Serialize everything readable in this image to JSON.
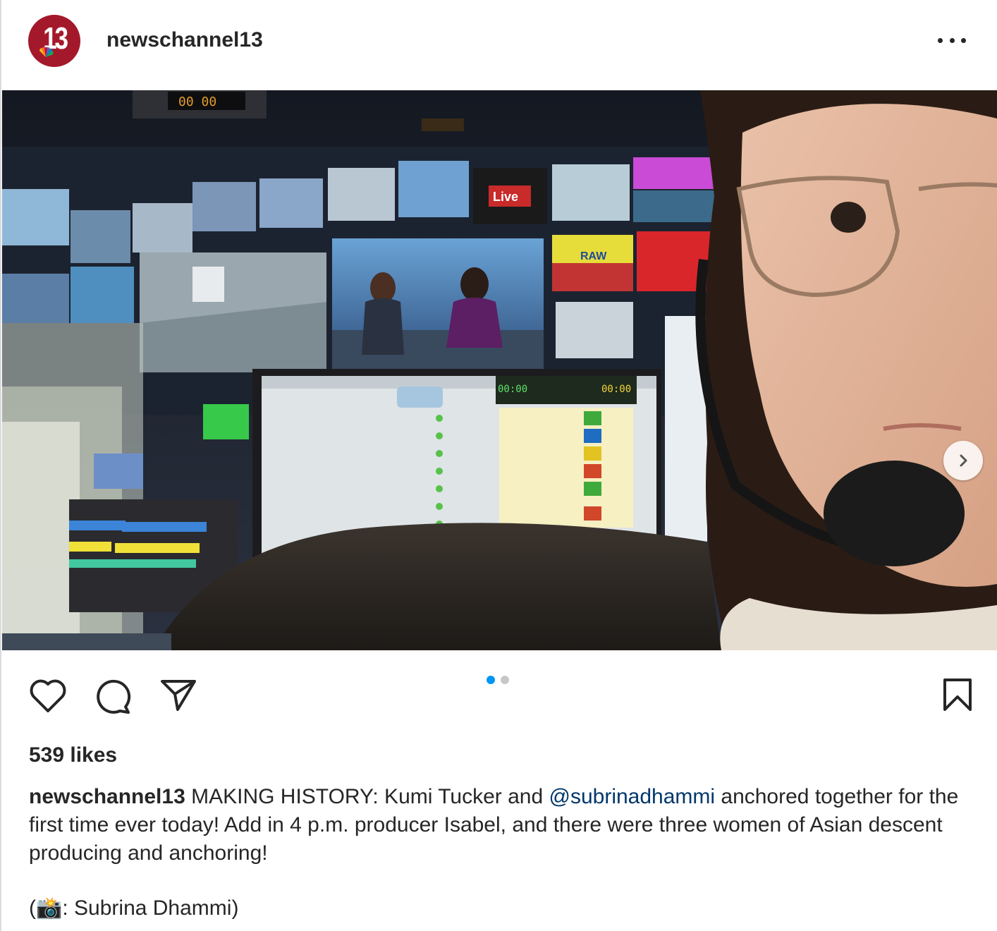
{
  "post": {
    "username": "newschannel13",
    "avatar_text": "13",
    "likes": "539 likes",
    "caption": {
      "username": "newschannel13",
      "part1": " MAKING HISTORY: Kumi Tucker and ",
      "mention": "@subrinadhammi",
      "part2": " anchored together for the first time ever today! Add in 4 p.m. producer Isabel, and there were three women of Asian descent producing and anchoring!"
    },
    "credit": {
      "open": "(",
      "emoji": "📸",
      "text": ": Subrina Dhammi)"
    },
    "carousel": {
      "current": 1,
      "total": 2
    }
  },
  "photo_text": {
    "clock": "00 00",
    "live_badge": "Live",
    "raw_label": "RAW",
    "timer_left": "00:00",
    "timer_right": "00:00"
  },
  "colors": {
    "brand": "#a3192b",
    "accent_blue": "#0095f6",
    "mention": "#00376b",
    "text": "#262626"
  },
  "icons": [
    "heart-icon",
    "comment-icon",
    "share-icon",
    "bookmark-icon",
    "more-icon",
    "chevron-right-icon"
  ]
}
